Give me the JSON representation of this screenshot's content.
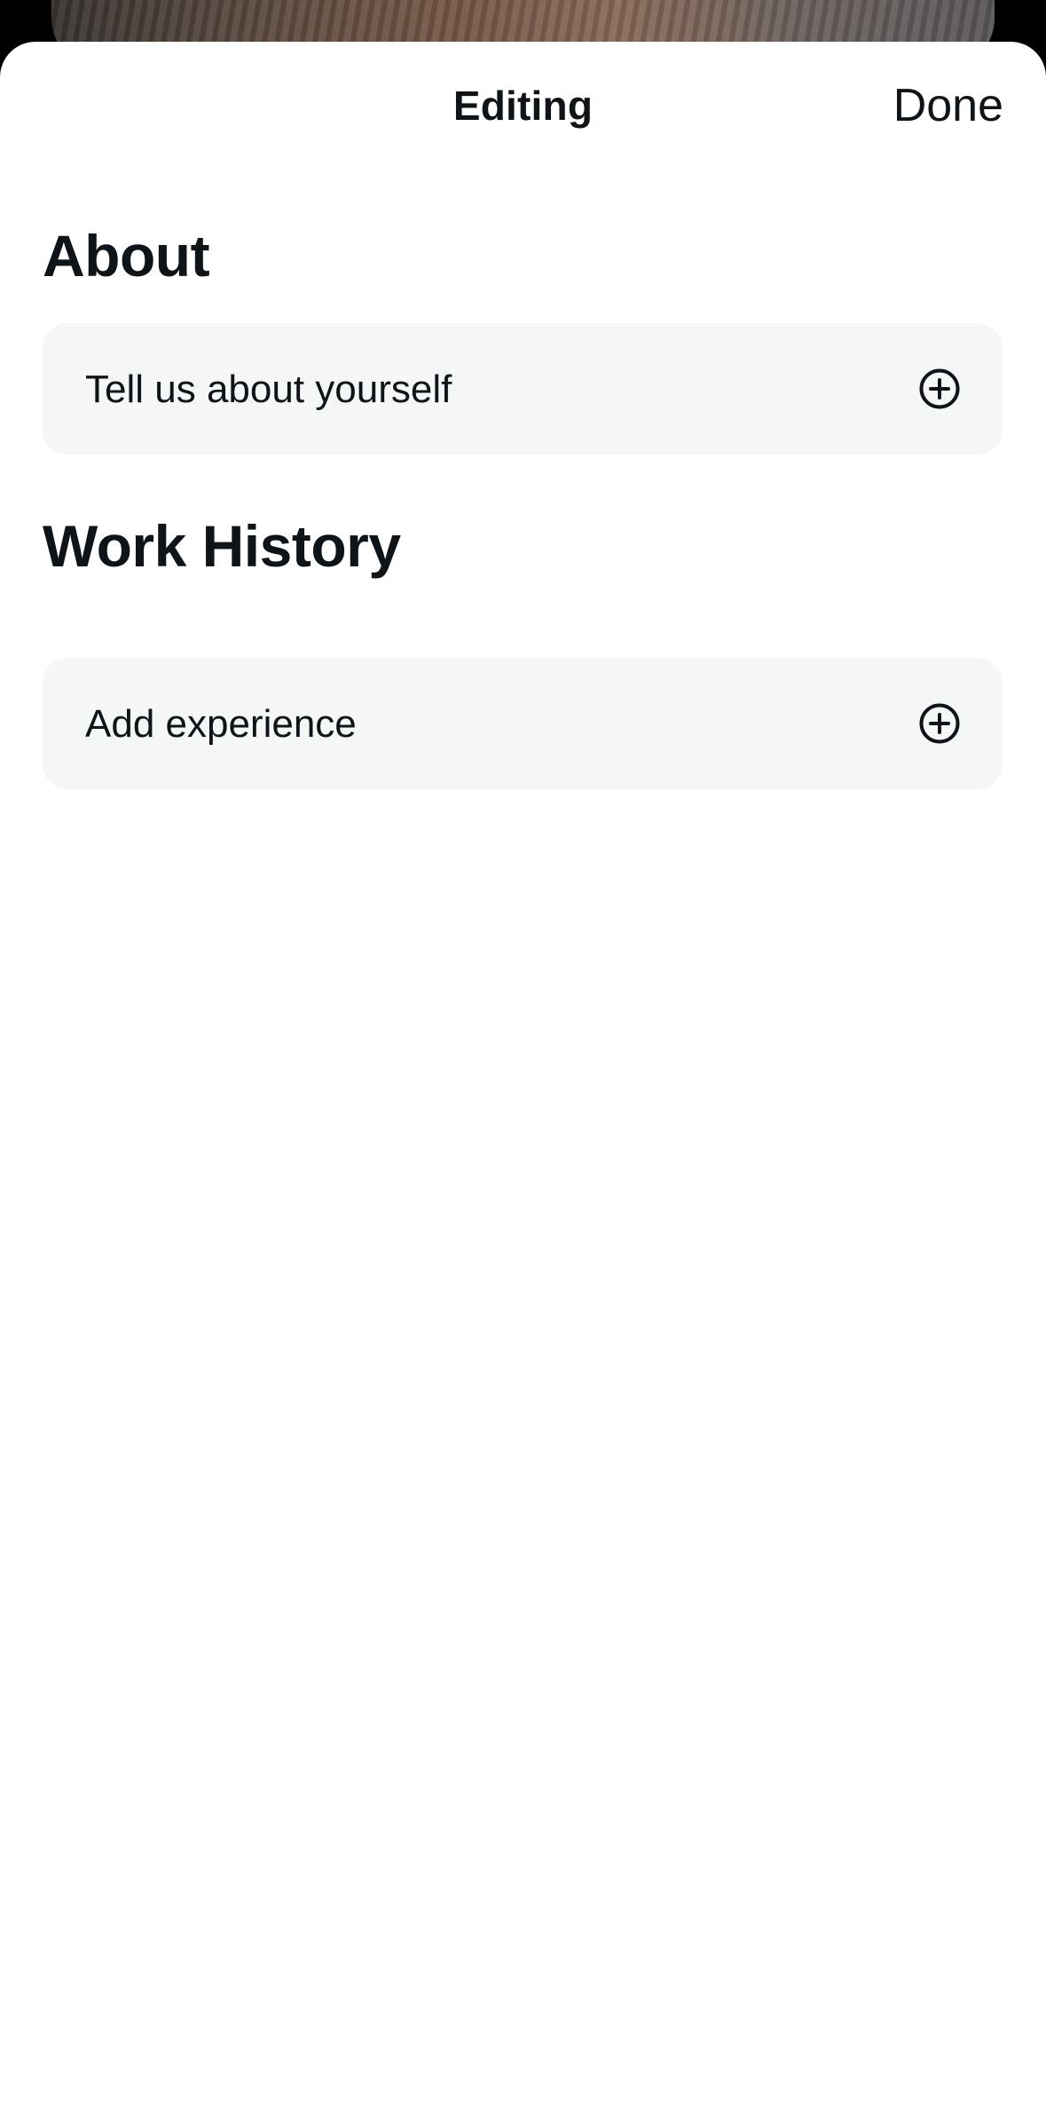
{
  "header": {
    "title": "Editing",
    "done_label": "Done"
  },
  "about": {
    "heading": "About",
    "card_label": "Tell us about yourself",
    "icon": "plus-circle-icon"
  },
  "work_history": {
    "heading": "Work History",
    "card_label": "Add experience",
    "icon": "plus-circle-icon"
  },
  "colors": {
    "text": "#0f1419",
    "card_background": "#f5f7f7",
    "sheet_background": "#ffffff"
  }
}
